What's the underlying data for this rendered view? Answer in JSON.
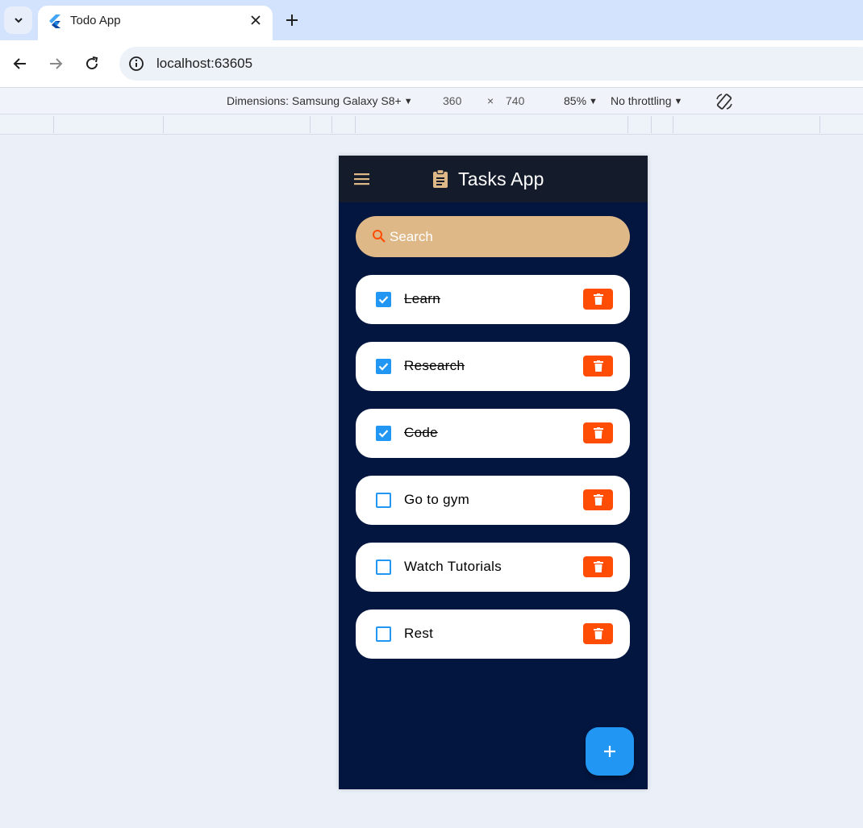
{
  "browser": {
    "tab_title": "Todo App",
    "url": "localhost:63605",
    "device_toolbar": {
      "dimensions_label": "Dimensions: Samsung Galaxy S8+",
      "width": "360",
      "times": "×",
      "height": "740",
      "zoom": "85%",
      "throttling": "No throttling"
    }
  },
  "app": {
    "title": "Tasks App",
    "search_placeholder": "Search",
    "tasks": [
      {
        "label": "Learn",
        "done": true
      },
      {
        "label": "Research",
        "done": true
      },
      {
        "label": "Code",
        "done": true
      },
      {
        "label": "Go to gym",
        "done": false
      },
      {
        "label": "Watch Tutorials",
        "done": false
      },
      {
        "label": "Rest",
        "done": false
      }
    ],
    "colors": {
      "background": "#031640",
      "appbar": "#141c2c",
      "search": "#deb887",
      "accent": "#2196f3",
      "delete": "#ff4d05"
    }
  }
}
